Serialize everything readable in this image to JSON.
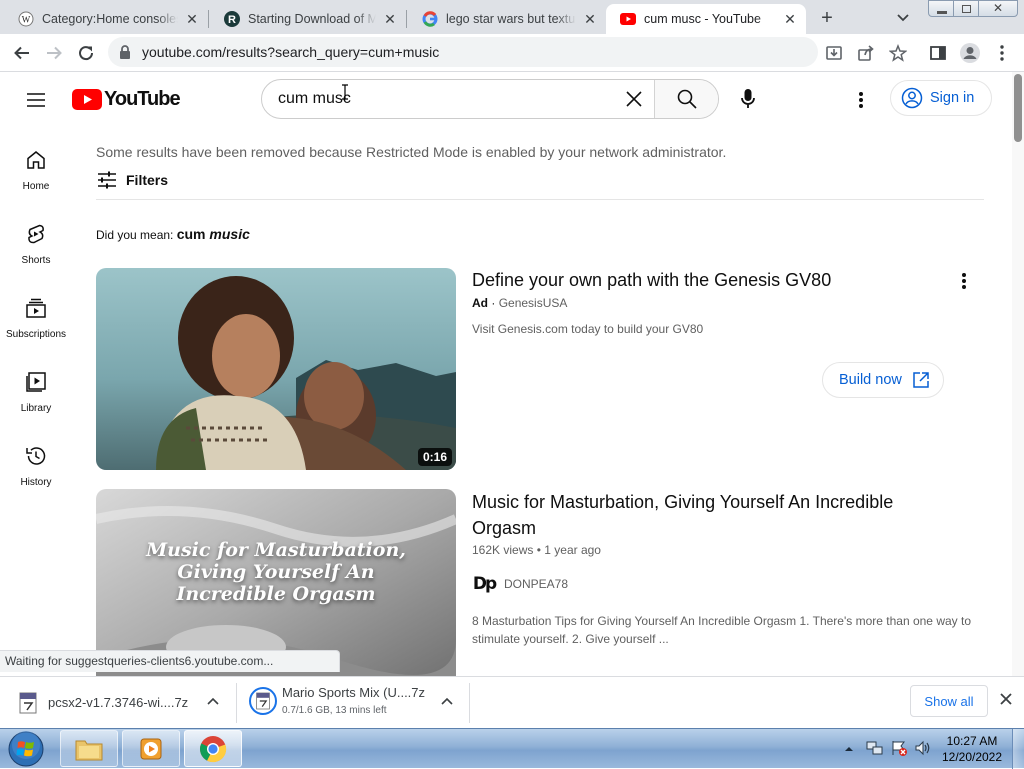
{
  "browser": {
    "tabs": [
      {
        "title": "Category:Home consoles",
        "icon": "wikipedia-icon",
        "active": false
      },
      {
        "title": "Starting Download of Ma",
        "icon": "r-site-icon",
        "active": false
      },
      {
        "title": "lego star wars but texture",
        "icon": "google-icon",
        "active": false
      },
      {
        "title": "cum musc - YouTube",
        "icon": "youtube-icon",
        "active": true
      }
    ],
    "url": "youtube.com/results?search_query=cum+music",
    "status_text": "Waiting for suggestqueries-clients6.youtube.com..."
  },
  "youtube": {
    "logo_text": "YouTube",
    "search_value": "cum musc",
    "sign_in_label": "Sign in",
    "sidebar": [
      {
        "label": "Home",
        "icon": "home-icon"
      },
      {
        "label": "Shorts",
        "icon": "shorts-icon"
      },
      {
        "label": "Subscriptions",
        "icon": "subscriptions-icon"
      },
      {
        "label": "Library",
        "icon": "library-icon"
      },
      {
        "label": "History",
        "icon": "history-icon"
      }
    ],
    "restricted_notice": "Some results have been removed because Restricted Mode is enabled by your network administrator.",
    "filters_label": "Filters",
    "did_you_mean_prefix": "Did you mean:",
    "did_you_mean_word1": "cum",
    "did_you_mean_word2": "music",
    "results": [
      {
        "title": "Define your own path with the Genesis GV80",
        "ad_label": "Ad",
        "channel": "GenesisUSA",
        "description": "Visit Genesis.com today to build your GV80",
        "duration": "0:16",
        "cta_label": "Build now"
      },
      {
        "title_line1": "Music for Masturbation, Giving Yourself An Incredible",
        "title_line2": "Orgasm",
        "views": "162K views",
        "age": "1 year ago",
        "channel": "DONPEA78",
        "channel_avatar": "Dp",
        "desc_line1": "8 Masturbation Tips for Giving Yourself An Incredible Orgasm 1. There's more than one way to",
        "desc_line2": "stimulate yourself. 2. Give yourself ...",
        "thumb_line1": "Music for Masturbation,",
        "thumb_line2": "Giving Yourself An",
        "thumb_line3": "Incredible Orgasm"
      }
    ]
  },
  "downloads": {
    "items": [
      {
        "name": "pcsx2-v1.7.3746-wi....7z",
        "status": ""
      },
      {
        "name": "Mario Sports Mix (U....7z",
        "status": "0.7/1.6 GB, 13 mins left"
      }
    ],
    "show_all_label": "Show all"
  },
  "taskbar": {
    "time": "10:27 AM",
    "date": "12/20/2022"
  },
  "colors": {
    "youtube_red": "#ff0000",
    "link_blue": "#065fd4",
    "chrome_tab_bg": "#dee1e6"
  }
}
